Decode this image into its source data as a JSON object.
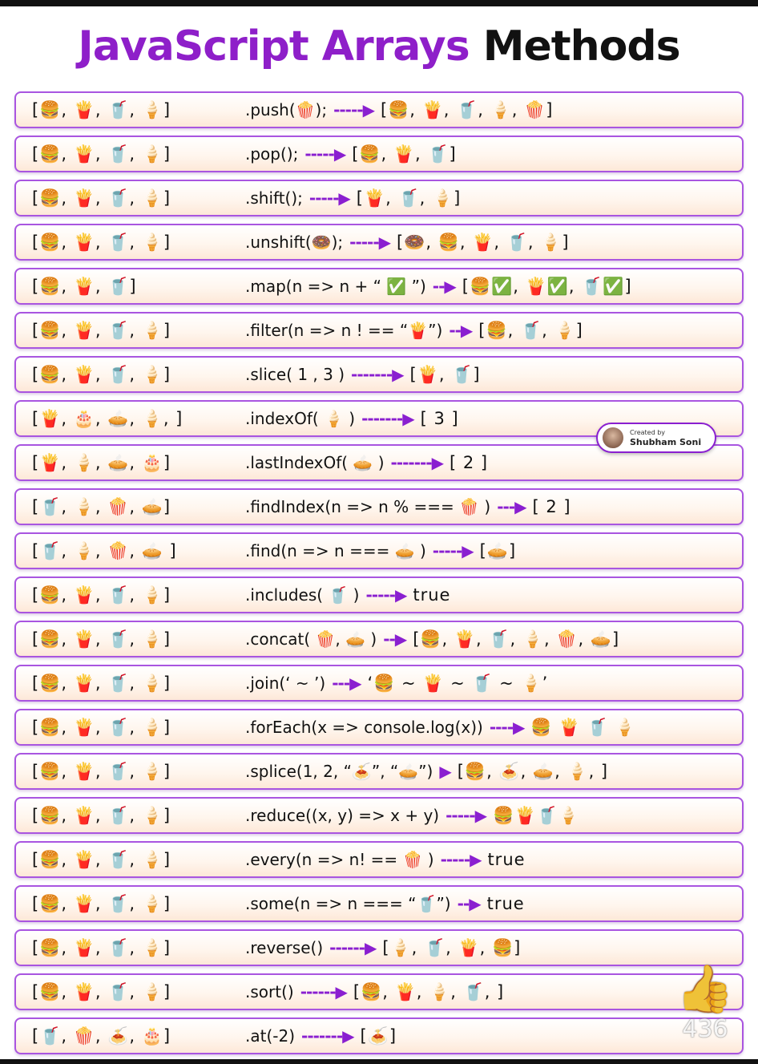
{
  "title": {
    "part1": "JavaScript Arrays",
    "part2": "Methods"
  },
  "rows": [
    {
      "input": "[🍔, 🍟, 🥤, 🍦]",
      "method": ".push(🍿);",
      "arrow": "-----▶",
      "output": "[🍔, 🍟, 🥤, 🍦, 🍿]"
    },
    {
      "input": "[🍔, 🍟, 🥤, 🍦]",
      "method": ".pop();",
      "arrow": "-----▶",
      "output": "[🍔, 🍟, 🥤]"
    },
    {
      "input": "[🍔, 🍟, 🥤, 🍦]",
      "method": ".shift();",
      "arrow": "-----▶",
      "output": "[🍟, 🥤, 🍦]"
    },
    {
      "input": "[🍔, 🍟, 🥤, 🍦]",
      "method": ".unshift(🍩);",
      "arrow": "-----▶",
      "output": "[🍩, 🍔, 🍟, 🥤, 🍦]"
    },
    {
      "input": "[🍔, 🍟, 🥤]",
      "method": ".map(n => n + “ ✅ ”)",
      "arrow": "--▶",
      "output": "[🍔✅, 🍟✅, 🥤✅]"
    },
    {
      "input": "[🍔, 🍟, 🥤, 🍦]",
      "method": ".filter(n => n ! == “🍟”)",
      "arrow": "--▶",
      "output": "[🍔, 🥤, 🍦]"
    },
    {
      "input": "[🍔, 🍟, 🥤, 🍦]",
      "method": ".slice( 1 , 3 )",
      "arrow": "-------▶",
      "output": "[🍟, 🥤]"
    },
    {
      "input": "[🍟, 🎂, 🥧, 🍦, ]",
      "method": ".indexOf( 🍦 )",
      "arrow": "-------▶",
      "output": "[ 3 ]"
    },
    {
      "input": "[🍟, 🍦, 🥧, 🎂]",
      "method": ".lastIndexOf( 🥧 )",
      "arrow": "-------▶",
      "output": "[ 2 ]"
    },
    {
      "input": "[🥤, 🍦, 🍿, 🥧]",
      "method": ".findIndex(n => n % === 🍿 )",
      "arrow": "---▶",
      "output": "[ 2 ]"
    },
    {
      "input": "[🥤, 🍦, 🍿, 🥧 ]",
      "method": ".find(n => n === 🥧 )",
      "arrow": "-----▶",
      "output": "[🥧]"
    },
    {
      "input": "[🍔, 🍟, 🥤, 🍦]",
      "method": ".includes( 🥤 )",
      "arrow": "-----▶",
      "output": "true"
    },
    {
      "input": "[🍔, 🍟, 🥤, 🍦]",
      "method": ".concat( 🍿, 🥧 )",
      "arrow": "--▶",
      "output": "[🍔, 🍟, 🥤, 🍦, 🍿, 🥧]"
    },
    {
      "input": "[🍔, 🍟, 🥤, 🍦]",
      "method": ".join(‘ ~ ’)",
      "arrow": "---▶",
      "output": "‘🍔 ~ 🍟 ~ 🥤 ~ 🍦’"
    },
    {
      "input": "[🍔, 🍟, 🥤, 🍦]",
      "method": ".forEach(x => console.log(x))",
      "arrow": "----▶",
      "output": "🍔 🍟 🥤 🍦"
    },
    {
      "input": "[🍔, 🍟, 🥤, 🍦]",
      "method": ".splice(1, 2, “🍝”, “🥧”)",
      "arrow": "▶",
      "output": "[🍔, 🍝, 🥧, 🍦, ]"
    },
    {
      "input": "[🍔, 🍟, 🥤, 🍦]",
      "method": ".reduce((x, y) => x + y)",
      "arrow": "-----▶",
      "output": "🍔🍟🥤🍦"
    },
    {
      "input": "[🍔, 🍟, 🥤, 🍦]",
      "method": ".every(n => n! == 🍿 )",
      "arrow": "-----▶",
      "output": "true"
    },
    {
      "input": "[🍔, 🍟, 🥤, 🍦]",
      "method": ".some(n => n === “🥤”)",
      "arrow": "--▶",
      "output": "true"
    },
    {
      "input": "[🍔, 🍟, 🥤, 🍦]",
      "method": ".reverse()",
      "arrow": "------▶",
      "output": "[🍦, 🥤, 🍟, 🍔]"
    },
    {
      "input": "[🍔, 🍟, 🥤, 🍦]",
      "method": ".sort()",
      "arrow": "------▶",
      "output": "[🍔, 🍟, 🍦, 🥤, ]"
    },
    {
      "input": "[🥤, 🍿, 🍝, 🎂]",
      "method": ".at(-2)",
      "arrow": "-------▶",
      "output": "[🍝]"
    }
  ],
  "badge": {
    "small": "Created by",
    "name": "Shubham Soni"
  },
  "like": {
    "icon": "thumbs-up",
    "count": "436"
  },
  "colors": {
    "accent": "#8e1fc9",
    "arrow": "#8a1fd0",
    "rowBorder": "#a955e0"
  }
}
